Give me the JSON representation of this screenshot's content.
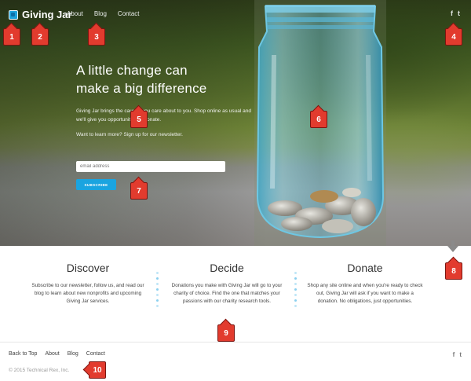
{
  "header": {
    "logo_text": "Giving Jar",
    "nav": [
      "About",
      "Blog",
      "Contact"
    ],
    "social": [
      "f",
      "t"
    ]
  },
  "hero": {
    "headline_line1": "A little change can",
    "headline_line2": "make a big difference",
    "lead": "Giving Jar brings the causes you care about to you. Shop online as usual and we'll give you opportunities to donate.",
    "cta": "Want to learn more? Sign up for our newsletter.",
    "email_placeholder": "email address",
    "subscribe_label": "SUBSCRIBE"
  },
  "features": [
    {
      "title": "Discover",
      "text": "Subscribe to our newsletter, follow us, and read our blog to learn about new nonprofits and upcoming Giving Jar services."
    },
    {
      "title": "Decide",
      "text": "Donations you make with Giving Jar will go to your charity of choice. Find the one that matches your passions with our charity research tools."
    },
    {
      "title": "Donate",
      "text": "Shop any site online and when you're ready to check out, Giving Jar will ask if you want to make a donation. No obligations, just opportunities."
    }
  ],
  "footer": {
    "nav": [
      "Back to Top",
      "About",
      "Blog",
      "Contact"
    ],
    "social": [
      "f",
      "t"
    ],
    "copyright": "© 2015 Technical Rex, Inc."
  },
  "callouts": [
    "1",
    "2",
    "3",
    "4",
    "5",
    "6",
    "7",
    "8",
    "9",
    "10"
  ],
  "colors": {
    "accent": "#1aa4e0",
    "callout": "#e23b2e"
  },
  "icons": {
    "social_facebook": "facebook-icon",
    "social_twitter": "twitter-icon",
    "scroll": "arrow-down-icon"
  }
}
